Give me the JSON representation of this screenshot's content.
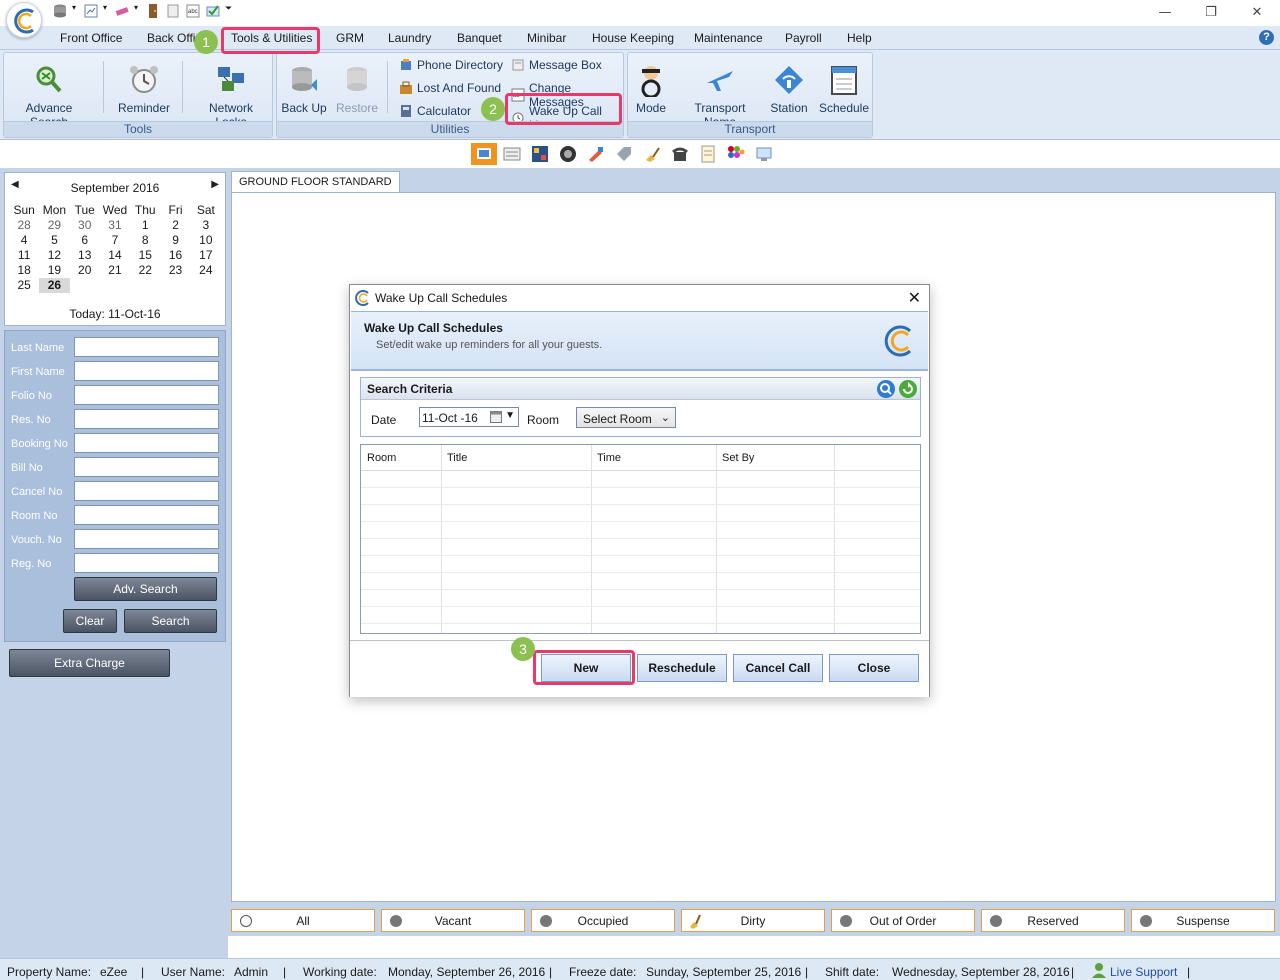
{
  "menu": {
    "items": [
      "Front Office",
      "Back Office",
      "Tools & Utilities",
      "GRM",
      "Laundry",
      "Banquet",
      "Minibar",
      "House Keeping",
      "Maintenance",
      "Payroll",
      "Help"
    ]
  },
  "ribbon": {
    "tools": {
      "label": "Tools",
      "advance_search": "Advance Search",
      "reminder": "Reminder",
      "network_locks": "Network Locks"
    },
    "utilities": {
      "label": "Utilities",
      "back_up": "Back Up",
      "restore": "Restore",
      "phone_directory": "Phone Directory",
      "lost_and_found": "Lost And Found",
      "calculator": "Calculator",
      "message_box": "Message Box",
      "change_messages": "Change Messages",
      "wake_up_call_list": "Wake Up Call List"
    },
    "transport": {
      "label": "Transport",
      "mode": "Mode",
      "transport_name": "Transport Name",
      "station": "Station",
      "schedule": "Schedule"
    }
  },
  "calendar": {
    "month_title": "September 2016",
    "weekdays": [
      "Sun",
      "Mon",
      "Tue",
      "Wed",
      "Thu",
      "Fri",
      "Sat"
    ],
    "weeks": [
      [
        "28",
        "29",
        "30",
        "31",
        "1",
        "2",
        "3"
      ],
      [
        "4",
        "5",
        "6",
        "7",
        "8",
        "9",
        "10"
      ],
      [
        "11",
        "12",
        "13",
        "14",
        "15",
        "16",
        "17"
      ],
      [
        "18",
        "19",
        "20",
        "21",
        "22",
        "23",
        "24"
      ],
      [
        "25",
        "26",
        "",
        "",
        "",
        "",
        ""
      ]
    ],
    "selected_day": "26",
    "today_label": "Today: 11-Oct-16"
  },
  "search_form": {
    "fields": [
      "Last Name",
      "First Name",
      "Folio No",
      "Res. No",
      "Booking No",
      "Bill No",
      "Cancel No",
      "Room No",
      "Vouch. No",
      "Reg. No"
    ],
    "adv_search": "Adv. Search",
    "clear": "Clear",
    "search": "Search",
    "extra_charge": "Extra Charge"
  },
  "main": {
    "tab_label": "GROUND FLOOR STANDARD"
  },
  "legend": [
    "All",
    "Vacant",
    "Occupied",
    "Dirty",
    "Out of Order",
    "Reserved",
    "Suspense"
  ],
  "status_bar": {
    "property_label": "Property Name:",
    "property_value": "eZee",
    "user_label": "User Name:",
    "user_value": "Admin",
    "working_label": "Working date:",
    "working_value": "Monday, September 26, 2016",
    "freeze_label": "Freeze date:",
    "freeze_value": "Sunday, September 25, 2016",
    "shift_label": "Shift date:",
    "shift_value": "Wednesday, September 28, 2016",
    "live_support": "Live Support"
  },
  "dialog": {
    "window_title": "Wake Up Call Schedules",
    "header_title": "Wake Up Call Schedules",
    "header_subtitle": "Set/edit wake up reminders for all your guests.",
    "criteria_title": "Search Criteria",
    "date_label": "Date",
    "date_value": "11-Oct -16",
    "room_label": "Room",
    "room_value": "Select Room",
    "columns": [
      "Room",
      "Title",
      "Time",
      "Set By"
    ],
    "buttons": {
      "new": "New",
      "reschedule": "Reschedule",
      "cancel_call": "Cancel Call",
      "close": "Close"
    }
  },
  "annotations": {
    "step1": "1",
    "step2": "2",
    "step3": "3"
  },
  "colors": {
    "highlight": "#e73a6a",
    "step_badge": "#8cc152",
    "ribbon_bg": "#dfe9f6",
    "panel_bg": "#c4d3e8"
  }
}
